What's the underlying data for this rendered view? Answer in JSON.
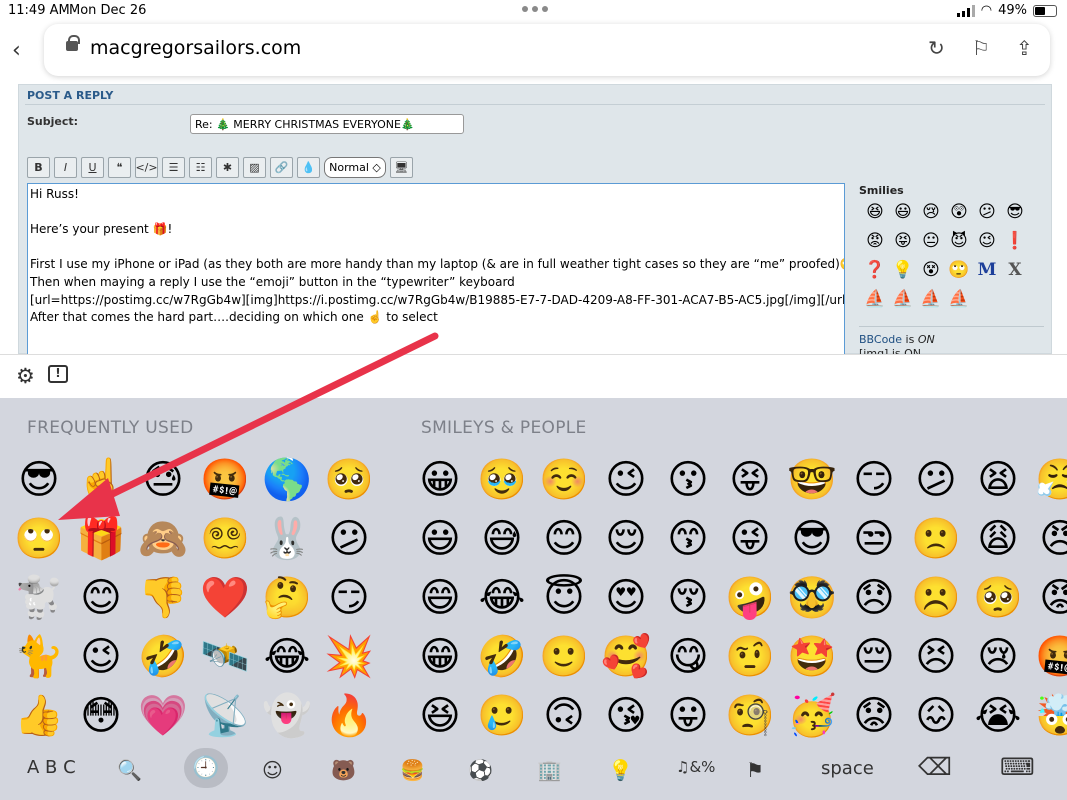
{
  "status": {
    "time": "11:49 AM",
    "date": "Mon Dec 26",
    "battery": "49%",
    "battery_level": 0.49
  },
  "browser": {
    "url": "macgregorsailors.com"
  },
  "form": {
    "heading": "POST A REPLY",
    "subject_label": "Subject:",
    "subject_value": "Re: 🎄 MERRY CHRISTMAS EVERYONE🎄",
    "toolbar": {
      "bold": "B",
      "italic": "I",
      "underline": "U",
      "quote": "❝",
      "code": "</>",
      "list": "☰",
      "olist": "☷",
      "star": "✱",
      "image": "▨",
      "link": "🔗",
      "color": "💧",
      "size": "Normal ◇",
      "preview": "🖥"
    },
    "message_lines": [
      "Hi Russ!",
      "",
      "Here’s your present 🎁!",
      "",
      "First I use my iPhone or iPad (as they both are more handy than my laptop (& are in full weather tight cases so they are “me” proofed)🙄",
      "Then when maying a reply I use the “emoji” button in the “typewriter” keyboard",
      "[url=https://postimg.cc/w7RgGb4w][img]https://i.postimg.cc/w7RgGb4w/B19885-E7-7-DAD-4209-A8-FF-301-ACA7-B5-AC5.jpg[/img][/url]",
      "After that comes the hard part….deciding on which one ☝️ to select"
    ],
    "smilies_title": "Smilies",
    "smilies": [
      "😆",
      "😃",
      "😢",
      "😲",
      "😕",
      "😎",
      "😡",
      "😝",
      "😐",
      "😈",
      "😉",
      "❗",
      "❓",
      "💡",
      "😵",
      "🙄",
      "M",
      "X",
      "⛵",
      "⛵",
      "⛵",
      "⛵"
    ],
    "bbcode_link": "BBCode",
    "bbcode_is": " is ",
    "bbcode_state": "ON",
    "img_line": "[img] is ON"
  },
  "accessory": {
    "settings_icon": "⚙",
    "feedback_icon": "!"
  },
  "keyboard": {
    "frequently_used_label": "FREQUENTLY USED",
    "smileys_label": "SMILEYS & PEOPLE",
    "frequently_used": [
      [
        "😎",
        "🙄",
        "🐩",
        "🐈",
        "👍"
      ],
      [
        "☝️",
        "🎁",
        "😊",
        "😉",
        "😳"
      ],
      [
        "😓",
        "🙈",
        "👎",
        "🤣",
        "💗"
      ],
      [
        "🤬",
        "😵‍💫",
        "❤️",
        "🛰️",
        "📡"
      ],
      [
        "🌎",
        "🐰",
        "🤔",
        "😂",
        "👻"
      ],
      [
        "🥺",
        "😕",
        "😏",
        "💥",
        "🔥"
      ]
    ],
    "smileys": [
      [
        "😀",
        "😃",
        "😄",
        "😁",
        "😆"
      ],
      [
        "🥹",
        "😅",
        "😂",
        "🤣",
        "🥲"
      ],
      [
        "☺️",
        "😊",
        "😇",
        "🙂",
        "🙃"
      ],
      [
        "😉",
        "😌",
        "😍",
        "🥰",
        "😘"
      ],
      [
        "😗",
        "😙",
        "😚",
        "😋",
        "😛"
      ],
      [
        "😝",
        "😜",
        "🤪",
        "🤨",
        "🧐"
      ],
      [
        "🤓",
        "😎",
        "🥸",
        "🤩",
        "🥳"
      ],
      [
        "😏",
        "😒",
        "😞",
        "😔",
        "😟"
      ],
      [
        "😕",
        "🙁",
        "☹️",
        "😣",
        "😖"
      ],
      [
        "😫",
        "😩",
        "🥺",
        "😢",
        "😭"
      ],
      [
        "😤",
        "😠",
        "😡",
        "🤬",
        "🤯"
      ]
    ],
    "bottom": {
      "abc": "A B C",
      "search": "🔍",
      "recent": "🕘",
      "smileys_cat": "☺",
      "animals_cat": "🐻",
      "food_cat": "🍔",
      "activity_cat": "⚽",
      "travel_cat": "🏢",
      "objects_cat": "💡",
      "symbols_cat": "♫&%",
      "flags_cat": "⚑",
      "space": "space",
      "delete": "⌫",
      "dismiss": "⌨"
    }
  },
  "annotation": {
    "color": "#e8334a"
  }
}
